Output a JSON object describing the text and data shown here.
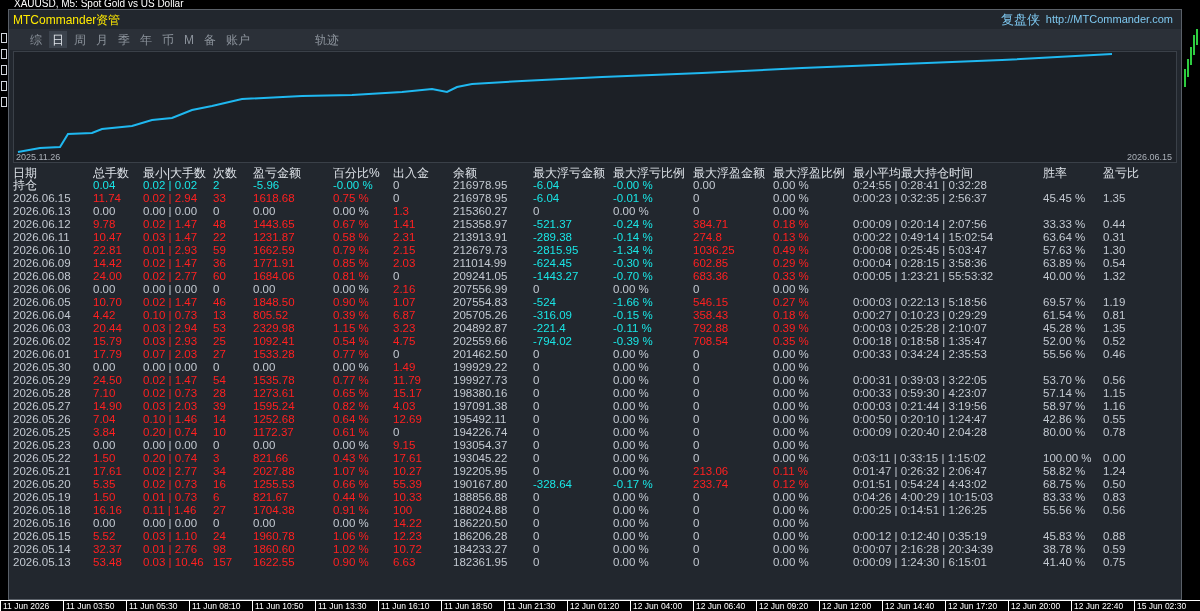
{
  "window": {
    "title": "XAUUSD, M5:  Spot Gold vs US Dollar"
  },
  "panel": {
    "title": "MTCommander资管",
    "brand": "复盘侠",
    "url": "http://MTCommander.com"
  },
  "tabs": [
    {
      "label": "综",
      "selected": false
    },
    {
      "label": "日",
      "selected": true
    },
    {
      "label": "周",
      "selected": false
    },
    {
      "label": "月",
      "selected": false
    },
    {
      "label": "季",
      "selected": false
    },
    {
      "label": "年",
      "selected": false
    },
    {
      "label": "币",
      "selected": false
    },
    {
      "label": "M",
      "selected": false
    },
    {
      "label": "备",
      "selected": false
    },
    {
      "label": "账户",
      "selected": false
    }
  ],
  "view_tab": {
    "label": "轨迹",
    "selected": false
  },
  "equity_chart": {
    "start_label": "2025.11.26",
    "end_label": "2026.06.15"
  },
  "table": {
    "columns": [
      "日期",
      "总手数",
      "最小|大手数",
      "次数",
      "盈亏金额",
      "百分比%",
      "出入金",
      "余额",
      "最大浮亏金额",
      "最大浮亏比例",
      "最大浮盈金额",
      "最大浮盈比例",
      "最小平均最大持仓时间",
      "胜率",
      "盈亏比"
    ],
    "rows": [
      {
        "cells": [
          {
            "text": "持仓",
            "kind": "label"
          },
          {
            "text": "0.04",
            "kind": "open"
          },
          {
            "text": "0.02 | 0.02",
            "kind": "open"
          },
          {
            "text": "2",
            "kind": "open"
          },
          {
            "text": "-5.96",
            "kind": "open"
          },
          {
            "text": "-0.00 %",
            "kind": "open"
          },
          {
            "text": "0",
            "kind": "plain"
          },
          {
            "text": "216978.95",
            "kind": "plain"
          },
          {
            "text": "-6.04",
            "kind": "open"
          },
          {
            "text": "-0.00 %",
            "kind": "open"
          },
          {
            "text": "0.00",
            "kind": "plain"
          },
          {
            "text": "0.00 %",
            "kind": "plain"
          },
          {
            "text": "0:24:55 | 0:28:41 | 0:32:28",
            "kind": "plain"
          }
        ]
      },
      {
        "cells": [
          {
            "text": "2026.06.15",
            "kind": "plain"
          },
          {
            "text": "11.74",
            "kind": "up"
          },
          {
            "text": "0.02 | 2.94",
            "kind": "up"
          },
          {
            "text": "33",
            "kind": "up"
          },
          {
            "text": "1618.68",
            "kind": "up"
          },
          {
            "text": "0.75 %",
            "kind": "up"
          },
          {
            "text": "0",
            "kind": "plain"
          },
          {
            "text": "216978.95",
            "kind": "plain"
          },
          {
            "text": "-6.04",
            "kind": "open"
          },
          {
            "text": "-0.01 %",
            "kind": "open"
          },
          {
            "text": "0",
            "kind": "plain"
          },
          {
            "text": "0.00 %",
            "kind": "plain"
          },
          {
            "text": "0:00:23 | 0:32:35 | 2:56:37",
            "kind": "plain"
          },
          {
            "text": "45.45 %",
            "kind": "plain"
          },
          {
            "text": "1.35",
            "kind": "plain"
          }
        ]
      },
      {
        "cells": [
          {
            "text": "2026.06.13",
            "kind": "plain"
          },
          {
            "text": "0.00",
            "kind": "plain"
          },
          {
            "text": "0.00 | 0.00",
            "kind": "plain"
          },
          {
            "text": "0",
            "kind": "plain"
          },
          {
            "text": "0.00",
            "kind": "plain"
          },
          {
            "text": "0.00 %",
            "kind": "plain"
          },
          {
            "text": "1.3",
            "kind": "up"
          },
          {
            "text": "215360.27",
            "kind": "plain"
          },
          {
            "text": "0",
            "kind": "plain"
          },
          {
            "text": "0.00 %",
            "kind": "plain"
          },
          {
            "text": "0",
            "kind": "plain"
          },
          {
            "text": "0.00 %",
            "kind": "plain"
          }
        ]
      },
      {
        "cells": [
          {
            "text": "2026.06.12",
            "kind": "plain"
          },
          {
            "text": "9.78",
            "kind": "up"
          },
          {
            "text": "0.02 | 1.47",
            "kind": "up"
          },
          {
            "text": "48",
            "kind": "up"
          },
          {
            "text": "1443.65",
            "kind": "up"
          },
          {
            "text": "0.67 %",
            "kind": "up"
          },
          {
            "text": "1.41",
            "kind": "up"
          },
          {
            "text": "215358.97",
            "kind": "plain"
          },
          {
            "text": "-521.37",
            "kind": "open"
          },
          {
            "text": "-0.24 %",
            "kind": "open"
          },
          {
            "text": "384.71",
            "kind": "up"
          },
          {
            "text": "0.18 %",
            "kind": "up"
          },
          {
            "text": "0:00:09 | 0:20:14 | 2:07:56",
            "kind": "plain"
          },
          {
            "text": "33.33 %",
            "kind": "plain"
          },
          {
            "text": "0.44",
            "kind": "plain"
          }
        ]
      },
      {
        "cells": [
          {
            "text": "2026.06.11",
            "kind": "plain"
          },
          {
            "text": "10.47",
            "kind": "up"
          },
          {
            "text": "0.03 | 1.47",
            "kind": "up"
          },
          {
            "text": "22",
            "kind": "up"
          },
          {
            "text": "1231.87",
            "kind": "up"
          },
          {
            "text": "0.58 %",
            "kind": "up"
          },
          {
            "text": "2.31",
            "kind": "up"
          },
          {
            "text": "213913.91",
            "kind": "plain"
          },
          {
            "text": "-289.38",
            "kind": "open"
          },
          {
            "text": "-0.14 %",
            "kind": "open"
          },
          {
            "text": "274.8",
            "kind": "up"
          },
          {
            "text": "0.13 %",
            "kind": "up"
          },
          {
            "text": "0:00:22 | 0:49:14 | 15:02:54",
            "kind": "plain"
          },
          {
            "text": "63.64 %",
            "kind": "plain"
          },
          {
            "text": "0.31",
            "kind": "plain"
          }
        ]
      },
      {
        "cells": [
          {
            "text": "2026.06.10",
            "kind": "plain"
          },
          {
            "text": "22.81",
            "kind": "up"
          },
          {
            "text": "0.01 | 2.93",
            "kind": "up"
          },
          {
            "text": "59",
            "kind": "up"
          },
          {
            "text": "1662.59",
            "kind": "up"
          },
          {
            "text": "0.79 %",
            "kind": "up"
          },
          {
            "text": "2.15",
            "kind": "up"
          },
          {
            "text": "212679.73",
            "kind": "plain"
          },
          {
            "text": "-2815.95",
            "kind": "open"
          },
          {
            "text": "-1.34 %",
            "kind": "open"
          },
          {
            "text": "1036.25",
            "kind": "up"
          },
          {
            "text": "0.49 %",
            "kind": "up"
          },
          {
            "text": "0:00:08 | 0:25:45 | 5:03:47",
            "kind": "plain"
          },
          {
            "text": "57.63 %",
            "kind": "plain"
          },
          {
            "text": "1.30",
            "kind": "plain"
          }
        ]
      },
      {
        "cells": [
          {
            "text": "2026.06.09",
            "kind": "plain"
          },
          {
            "text": "14.42",
            "kind": "up"
          },
          {
            "text": "0.02 | 1.47",
            "kind": "up"
          },
          {
            "text": "36",
            "kind": "up"
          },
          {
            "text": "1771.91",
            "kind": "up"
          },
          {
            "text": "0.85 %",
            "kind": "up"
          },
          {
            "text": "2.03",
            "kind": "up"
          },
          {
            "text": "211014.99",
            "kind": "plain"
          },
          {
            "text": "-624.45",
            "kind": "open"
          },
          {
            "text": "-0.30 %",
            "kind": "open"
          },
          {
            "text": "602.85",
            "kind": "up"
          },
          {
            "text": "0.29 %",
            "kind": "up"
          },
          {
            "text": "0:00:04 | 0:28:15 | 3:58:36",
            "kind": "plain"
          },
          {
            "text": "63.89 %",
            "kind": "plain"
          },
          {
            "text": "0.54",
            "kind": "plain"
          }
        ]
      },
      {
        "cells": [
          {
            "text": "2026.06.08",
            "kind": "plain"
          },
          {
            "text": "24.00",
            "kind": "up"
          },
          {
            "text": "0.02 | 2.77",
            "kind": "up"
          },
          {
            "text": "60",
            "kind": "up"
          },
          {
            "text": "1684.06",
            "kind": "up"
          },
          {
            "text": "0.81 %",
            "kind": "up"
          },
          {
            "text": "0",
            "kind": "plain"
          },
          {
            "text": "209241.05",
            "kind": "plain"
          },
          {
            "text": "-1443.27",
            "kind": "open"
          },
          {
            "text": "-0.70 %",
            "kind": "open"
          },
          {
            "text": "683.36",
            "kind": "up"
          },
          {
            "text": "0.33 %",
            "kind": "up"
          },
          {
            "text": "0:00:05 | 1:23:21 | 55:53:32",
            "kind": "plain"
          },
          {
            "text": "40.00 %",
            "kind": "plain"
          },
          {
            "text": "1.32",
            "kind": "plain"
          }
        ]
      },
      {
        "cells": [
          {
            "text": "2026.06.06",
            "kind": "plain"
          },
          {
            "text": "0.00",
            "kind": "plain"
          },
          {
            "text": "0.00 | 0.00",
            "kind": "plain"
          },
          {
            "text": "0",
            "kind": "plain"
          },
          {
            "text": "0.00",
            "kind": "plain"
          },
          {
            "text": "0.00 %",
            "kind": "plain"
          },
          {
            "text": "2.16",
            "kind": "up"
          },
          {
            "text": "207556.99",
            "kind": "plain"
          },
          {
            "text": "0",
            "kind": "plain"
          },
          {
            "text": "0.00 %",
            "kind": "plain"
          },
          {
            "text": "0",
            "kind": "plain"
          },
          {
            "text": "0.00 %",
            "kind": "plain"
          }
        ]
      },
      {
        "cells": [
          {
            "text": "2026.06.05",
            "kind": "plain"
          },
          {
            "text": "10.70",
            "kind": "up"
          },
          {
            "text": "0.02 | 1.47",
            "kind": "up"
          },
          {
            "text": "46",
            "kind": "up"
          },
          {
            "text": "1848.50",
            "kind": "up"
          },
          {
            "text": "0.90 %",
            "kind": "up"
          },
          {
            "text": "1.07",
            "kind": "up"
          },
          {
            "text": "207554.83",
            "kind": "plain"
          },
          {
            "text": "-524",
            "kind": "open"
          },
          {
            "text": "-1.66 %",
            "kind": "open"
          },
          {
            "text": "546.15",
            "kind": "up"
          },
          {
            "text": "0.27 %",
            "kind": "up"
          },
          {
            "text": "0:00:03 | 0:22:13 | 5:18:56",
            "kind": "plain"
          },
          {
            "text": "69.57 %",
            "kind": "plain"
          },
          {
            "text": "1.19",
            "kind": "plain"
          }
        ]
      },
      {
        "cells": [
          {
            "text": "2026.06.04",
            "kind": "plain"
          },
          {
            "text": "4.42",
            "kind": "up"
          },
          {
            "text": "0.10 | 0.73",
            "kind": "up"
          },
          {
            "text": "13",
            "kind": "up"
          },
          {
            "text": "805.52",
            "kind": "up"
          },
          {
            "text": "0.39 %",
            "kind": "up"
          },
          {
            "text": "6.87",
            "kind": "up"
          },
          {
            "text": "205705.26",
            "kind": "plain"
          },
          {
            "text": "-316.09",
            "kind": "open"
          },
          {
            "text": "-0.15 %",
            "kind": "open"
          },
          {
            "text": "358.43",
            "kind": "up"
          },
          {
            "text": "0.18 %",
            "kind": "up"
          },
          {
            "text": "0:00:27 | 0:10:23 | 0:29:29",
            "kind": "plain"
          },
          {
            "text": "61.54 %",
            "kind": "plain"
          },
          {
            "text": "0.81",
            "kind": "plain"
          }
        ]
      },
      {
        "cells": [
          {
            "text": "2026.06.03",
            "kind": "plain"
          },
          {
            "text": "20.44",
            "kind": "up"
          },
          {
            "text": "0.03 | 2.94",
            "kind": "up"
          },
          {
            "text": "53",
            "kind": "up"
          },
          {
            "text": "2329.98",
            "kind": "up"
          },
          {
            "text": "1.15 %",
            "kind": "up"
          },
          {
            "text": "3.23",
            "kind": "up"
          },
          {
            "text": "204892.87",
            "kind": "plain"
          },
          {
            "text": "-221.4",
            "kind": "open"
          },
          {
            "text": "-0.11 %",
            "kind": "open"
          },
          {
            "text": "792.88",
            "kind": "up"
          },
          {
            "text": "0.39 %",
            "kind": "up"
          },
          {
            "text": "0:00:03 | 0:25:28 | 2:10:07",
            "kind": "plain"
          },
          {
            "text": "45.28 %",
            "kind": "plain"
          },
          {
            "text": "1.35",
            "kind": "plain"
          }
        ]
      },
      {
        "cells": [
          {
            "text": "2026.06.02",
            "kind": "plain"
          },
          {
            "text": "15.79",
            "kind": "up"
          },
          {
            "text": "0.03 | 2.93",
            "kind": "up"
          },
          {
            "text": "25",
            "kind": "up"
          },
          {
            "text": "1092.41",
            "kind": "up"
          },
          {
            "text": "0.54 %",
            "kind": "up"
          },
          {
            "text": "4.75",
            "kind": "up"
          },
          {
            "text": "202559.66",
            "kind": "plain"
          },
          {
            "text": "-794.02",
            "kind": "open"
          },
          {
            "text": "-0.39 %",
            "kind": "open"
          },
          {
            "text": "708.54",
            "kind": "up"
          },
          {
            "text": "0.35 %",
            "kind": "up"
          },
          {
            "text": "0:00:18 | 0:18:58 | 1:35:47",
            "kind": "plain"
          },
          {
            "text": "52.00 %",
            "kind": "plain"
          },
          {
            "text": "0.52",
            "kind": "plain"
          }
        ]
      },
      {
        "cells": [
          {
            "text": "2026.06.01",
            "kind": "plain"
          },
          {
            "text": "17.79",
            "kind": "up"
          },
          {
            "text": "0.07 | 2.03",
            "kind": "up"
          },
          {
            "text": "27",
            "kind": "up"
          },
          {
            "text": "1533.28",
            "kind": "up"
          },
          {
            "text": "0.77 %",
            "kind": "up"
          },
          {
            "text": "0",
            "kind": "plain"
          },
          {
            "text": "201462.50",
            "kind": "plain"
          },
          {
            "text": "0",
            "kind": "plain"
          },
          {
            "text": "0.00 %",
            "kind": "plain"
          },
          {
            "text": "0",
            "kind": "plain"
          },
          {
            "text": "0.00 %",
            "kind": "plain"
          },
          {
            "text": "0:00:33 | 0:34:24 | 2:35:53",
            "kind": "plain"
          },
          {
            "text": "55.56 %",
            "kind": "plain"
          },
          {
            "text": "0.46",
            "kind": "plain"
          }
        ]
      },
      {
        "cells": [
          {
            "text": "2026.05.30",
            "kind": "plain"
          },
          {
            "text": "0.00",
            "kind": "plain"
          },
          {
            "text": "0.00 | 0.00",
            "kind": "plain"
          },
          {
            "text": "0",
            "kind": "plain"
          },
          {
            "text": "0.00",
            "kind": "plain"
          },
          {
            "text": "0.00 %",
            "kind": "plain"
          },
          {
            "text": "1.49",
            "kind": "up"
          },
          {
            "text": "199929.22",
            "kind": "plain"
          },
          {
            "text": "0",
            "kind": "plain"
          },
          {
            "text": "0.00 %",
            "kind": "plain"
          },
          {
            "text": "0",
            "kind": "plain"
          },
          {
            "text": "0.00 %",
            "kind": "plain"
          }
        ]
      },
      {
        "cells": [
          {
            "text": "2026.05.29",
            "kind": "plain"
          },
          {
            "text": "24.50",
            "kind": "up"
          },
          {
            "text": "0.02 | 1.47",
            "kind": "up"
          },
          {
            "text": "54",
            "kind": "up"
          },
          {
            "text": "1535.78",
            "kind": "up"
          },
          {
            "text": "0.77 %",
            "kind": "up"
          },
          {
            "text": "11.79",
            "kind": "up"
          },
          {
            "text": "199927.73",
            "kind": "plain"
          },
          {
            "text": "0",
            "kind": "plain"
          },
          {
            "text": "0.00 %",
            "kind": "plain"
          },
          {
            "text": "0",
            "kind": "plain"
          },
          {
            "text": "0.00 %",
            "kind": "plain"
          },
          {
            "text": "0:00:31 | 0:39:03 | 3:22:05",
            "kind": "plain"
          },
          {
            "text": "53.70 %",
            "kind": "plain"
          },
          {
            "text": "0.56",
            "kind": "plain"
          }
        ]
      },
      {
        "cells": [
          {
            "text": "2026.05.28",
            "kind": "plain"
          },
          {
            "text": "7.10",
            "kind": "up"
          },
          {
            "text": "0.02 | 0.73",
            "kind": "up"
          },
          {
            "text": "28",
            "kind": "up"
          },
          {
            "text": "1273.61",
            "kind": "up"
          },
          {
            "text": "0.65 %",
            "kind": "up"
          },
          {
            "text": "15.17",
            "kind": "up"
          },
          {
            "text": "198380.16",
            "kind": "plain"
          },
          {
            "text": "0",
            "kind": "plain"
          },
          {
            "text": "0.00 %",
            "kind": "plain"
          },
          {
            "text": "0",
            "kind": "plain"
          },
          {
            "text": "0.00 %",
            "kind": "plain"
          },
          {
            "text": "0:00:33 | 0:59:30 | 4:23:07",
            "kind": "plain"
          },
          {
            "text": "57.14 %",
            "kind": "plain"
          },
          {
            "text": "1.15",
            "kind": "plain"
          }
        ]
      },
      {
        "cells": [
          {
            "text": "2026.05.27",
            "kind": "plain"
          },
          {
            "text": "14.90",
            "kind": "up"
          },
          {
            "text": "0.03 | 2.03",
            "kind": "up"
          },
          {
            "text": "39",
            "kind": "up"
          },
          {
            "text": "1595.24",
            "kind": "up"
          },
          {
            "text": "0.82 %",
            "kind": "up"
          },
          {
            "text": "4.03",
            "kind": "up"
          },
          {
            "text": "197091.38",
            "kind": "plain"
          },
          {
            "text": "0",
            "kind": "plain"
          },
          {
            "text": "0.00 %",
            "kind": "plain"
          },
          {
            "text": "0",
            "kind": "plain"
          },
          {
            "text": "0.00 %",
            "kind": "plain"
          },
          {
            "text": "0:00:03 | 0:21:44 | 3:19:56",
            "kind": "plain"
          },
          {
            "text": "58.97 %",
            "kind": "plain"
          },
          {
            "text": "1.16",
            "kind": "plain"
          }
        ]
      },
      {
        "cells": [
          {
            "text": "2026.05.26",
            "kind": "plain"
          },
          {
            "text": "7.04",
            "kind": "up"
          },
          {
            "text": "0.10 | 1.46",
            "kind": "up"
          },
          {
            "text": "14",
            "kind": "up"
          },
          {
            "text": "1252.68",
            "kind": "up"
          },
          {
            "text": "0.64 %",
            "kind": "up"
          },
          {
            "text": "12.69",
            "kind": "up"
          },
          {
            "text": "195492.11",
            "kind": "plain"
          },
          {
            "text": "0",
            "kind": "plain"
          },
          {
            "text": "0.00 %",
            "kind": "plain"
          },
          {
            "text": "0",
            "kind": "plain"
          },
          {
            "text": "0.00 %",
            "kind": "plain"
          },
          {
            "text": "0:00:50 | 0:20:10 | 1:24:47",
            "kind": "plain"
          },
          {
            "text": "42.86 %",
            "kind": "plain"
          },
          {
            "text": "0.55",
            "kind": "plain"
          }
        ]
      },
      {
        "cells": [
          {
            "text": "2026.05.25",
            "kind": "plain"
          },
          {
            "text": "3.84",
            "kind": "up"
          },
          {
            "text": "0.20 | 0.74",
            "kind": "up"
          },
          {
            "text": "10",
            "kind": "up"
          },
          {
            "text": "1172.37",
            "kind": "up"
          },
          {
            "text": "0.61 %",
            "kind": "up"
          },
          {
            "text": "0",
            "kind": "plain"
          },
          {
            "text": "194226.74",
            "kind": "plain"
          },
          {
            "text": "0",
            "kind": "plain"
          },
          {
            "text": "0.00 %",
            "kind": "plain"
          },
          {
            "text": "0",
            "kind": "plain"
          },
          {
            "text": "0.00 %",
            "kind": "plain"
          },
          {
            "text": "0:00:09 | 0:20:40 | 2:04:28",
            "kind": "plain"
          },
          {
            "text": "80.00 %",
            "kind": "plain"
          },
          {
            "text": "0.78",
            "kind": "plain"
          }
        ]
      },
      {
        "cells": [
          {
            "text": "2026.05.23",
            "kind": "plain"
          },
          {
            "text": "0.00",
            "kind": "plain"
          },
          {
            "text": "0.00 | 0.00",
            "kind": "plain"
          },
          {
            "text": "0",
            "kind": "plain"
          },
          {
            "text": "0.00",
            "kind": "plain"
          },
          {
            "text": "0.00 %",
            "kind": "plain"
          },
          {
            "text": "9.15",
            "kind": "up"
          },
          {
            "text": "193054.37",
            "kind": "plain"
          },
          {
            "text": "0",
            "kind": "plain"
          },
          {
            "text": "0.00 %",
            "kind": "plain"
          },
          {
            "text": "0",
            "kind": "plain"
          },
          {
            "text": "0.00 %",
            "kind": "plain"
          }
        ]
      },
      {
        "cells": [
          {
            "text": "2026.05.22",
            "kind": "plain"
          },
          {
            "text": "1.50",
            "kind": "up"
          },
          {
            "text": "0.20 | 0.74",
            "kind": "up"
          },
          {
            "text": "3",
            "kind": "up"
          },
          {
            "text": "821.66",
            "kind": "up"
          },
          {
            "text": "0.43 %",
            "kind": "up"
          },
          {
            "text": "17.61",
            "kind": "up"
          },
          {
            "text": "193045.22",
            "kind": "plain"
          },
          {
            "text": "0",
            "kind": "plain"
          },
          {
            "text": "0.00 %",
            "kind": "plain"
          },
          {
            "text": "0",
            "kind": "plain"
          },
          {
            "text": "0.00 %",
            "kind": "plain"
          },
          {
            "text": "0:03:11 | 0:33:15 | 1:15:02",
            "kind": "plain"
          },
          {
            "text": "100.00 %",
            "kind": "plain"
          },
          {
            "text": "0.00",
            "kind": "plain"
          }
        ]
      },
      {
        "cells": [
          {
            "text": "2026.05.21",
            "kind": "plain"
          },
          {
            "text": "17.61",
            "kind": "up"
          },
          {
            "text": "0.02 | 2.77",
            "kind": "up"
          },
          {
            "text": "34",
            "kind": "up"
          },
          {
            "text": "2027.88",
            "kind": "up"
          },
          {
            "text": "1.07 %",
            "kind": "up"
          },
          {
            "text": "10.27",
            "kind": "up"
          },
          {
            "text": "192205.95",
            "kind": "plain"
          },
          {
            "text": "0",
            "kind": "plain"
          },
          {
            "text": "0.00 %",
            "kind": "plain"
          },
          {
            "text": "213.06",
            "kind": "up"
          },
          {
            "text": "0.11 %",
            "kind": "up"
          },
          {
            "text": "0:01:47 | 0:26:32 | 2:06:47",
            "kind": "plain"
          },
          {
            "text": "58.82 %",
            "kind": "plain"
          },
          {
            "text": "1.24",
            "kind": "plain"
          }
        ]
      },
      {
        "cells": [
          {
            "text": "2026.05.20",
            "kind": "plain"
          },
          {
            "text": "5.35",
            "kind": "up"
          },
          {
            "text": "0.02 | 0.73",
            "kind": "up"
          },
          {
            "text": "16",
            "kind": "up"
          },
          {
            "text": "1255.53",
            "kind": "up"
          },
          {
            "text": "0.66 %",
            "kind": "up"
          },
          {
            "text": "55.39",
            "kind": "up"
          },
          {
            "text": "190167.80",
            "kind": "plain"
          },
          {
            "text": "-328.64",
            "kind": "open"
          },
          {
            "text": "-0.17 %",
            "kind": "open"
          },
          {
            "text": "233.74",
            "kind": "up"
          },
          {
            "text": "0.12 %",
            "kind": "up"
          },
          {
            "text": "0:01:51 | 0:54:24 | 4:43:02",
            "kind": "plain"
          },
          {
            "text": "68.75 %",
            "kind": "plain"
          },
          {
            "text": "0.50",
            "kind": "plain"
          }
        ]
      },
      {
        "cells": [
          {
            "text": "2026.05.19",
            "kind": "plain"
          },
          {
            "text": "1.50",
            "kind": "up"
          },
          {
            "text": "0.01 | 0.73",
            "kind": "up"
          },
          {
            "text": "6",
            "kind": "up"
          },
          {
            "text": "821.67",
            "kind": "up"
          },
          {
            "text": "0.44 %",
            "kind": "up"
          },
          {
            "text": "10.33",
            "kind": "up"
          },
          {
            "text": "188856.88",
            "kind": "plain"
          },
          {
            "text": "0",
            "kind": "plain"
          },
          {
            "text": "0.00 %",
            "kind": "plain"
          },
          {
            "text": "0",
            "kind": "plain"
          },
          {
            "text": "0.00 %",
            "kind": "plain"
          },
          {
            "text": "0:04:26 | 4:00:29 | 10:15:03",
            "kind": "plain"
          },
          {
            "text": "83.33 %",
            "kind": "plain"
          },
          {
            "text": "0.83",
            "kind": "plain"
          }
        ]
      },
      {
        "cells": [
          {
            "text": "2026.05.18",
            "kind": "plain"
          },
          {
            "text": "16.16",
            "kind": "up"
          },
          {
            "text": "0.11 | 1.46",
            "kind": "up"
          },
          {
            "text": "27",
            "kind": "up"
          },
          {
            "text": "1704.38",
            "kind": "up"
          },
          {
            "text": "0.91 %",
            "kind": "up"
          },
          {
            "text": "100",
            "kind": "up"
          },
          {
            "text": "188024.88",
            "kind": "plain"
          },
          {
            "text": "0",
            "kind": "plain"
          },
          {
            "text": "0.00 %",
            "kind": "plain"
          },
          {
            "text": "0",
            "kind": "plain"
          },
          {
            "text": "0.00 %",
            "kind": "plain"
          },
          {
            "text": "0:00:25 | 0:14:51 | 1:26:25",
            "kind": "plain"
          },
          {
            "text": "55.56 %",
            "kind": "plain"
          },
          {
            "text": "0.56",
            "kind": "plain"
          }
        ]
      },
      {
        "cells": [
          {
            "text": "2026.05.16",
            "kind": "plain"
          },
          {
            "text": "0.00",
            "kind": "plain"
          },
          {
            "text": "0.00 | 0.00",
            "kind": "plain"
          },
          {
            "text": "0",
            "kind": "plain"
          },
          {
            "text": "0.00",
            "kind": "plain"
          },
          {
            "text": "0.00 %",
            "kind": "plain"
          },
          {
            "text": "14.22",
            "kind": "up"
          },
          {
            "text": "186220.50",
            "kind": "plain"
          },
          {
            "text": "0",
            "kind": "plain"
          },
          {
            "text": "0.00 %",
            "kind": "plain"
          },
          {
            "text": "0",
            "kind": "plain"
          },
          {
            "text": "0.00 %",
            "kind": "plain"
          }
        ]
      },
      {
        "cells": [
          {
            "text": "2026.05.15",
            "kind": "plain"
          },
          {
            "text": "5.52",
            "kind": "up"
          },
          {
            "text": "0.03 | 1.10",
            "kind": "up"
          },
          {
            "text": "24",
            "kind": "up"
          },
          {
            "text": "1960.78",
            "kind": "up"
          },
          {
            "text": "1.06 %",
            "kind": "up"
          },
          {
            "text": "12.23",
            "kind": "up"
          },
          {
            "text": "186206.28",
            "kind": "plain"
          },
          {
            "text": "0",
            "kind": "plain"
          },
          {
            "text": "0.00 %",
            "kind": "plain"
          },
          {
            "text": "0",
            "kind": "plain"
          },
          {
            "text": "0.00 %",
            "kind": "plain"
          },
          {
            "text": "0:00:12 | 0:12:40 | 0:35:19",
            "kind": "plain"
          },
          {
            "text": "45.83 %",
            "kind": "plain"
          },
          {
            "text": "0.88",
            "kind": "plain"
          }
        ]
      },
      {
        "cells": [
          {
            "text": "2026.05.14",
            "kind": "plain"
          },
          {
            "text": "32.37",
            "kind": "up"
          },
          {
            "text": "0.01 | 2.76",
            "kind": "up"
          },
          {
            "text": "98",
            "kind": "up"
          },
          {
            "text": "1860.60",
            "kind": "up"
          },
          {
            "text": "1.02 %",
            "kind": "up"
          },
          {
            "text": "10.72",
            "kind": "up"
          },
          {
            "text": "184233.27",
            "kind": "plain"
          },
          {
            "text": "0",
            "kind": "plain"
          },
          {
            "text": "0.00 %",
            "kind": "plain"
          },
          {
            "text": "0",
            "kind": "plain"
          },
          {
            "text": "0.00 %",
            "kind": "plain"
          },
          {
            "text": "0:00:07 | 2:16:28 | 20:34:39",
            "kind": "plain"
          },
          {
            "text": "38.78 %",
            "kind": "plain"
          },
          {
            "text": "0.59",
            "kind": "plain"
          }
        ]
      },
      {
        "cells": [
          {
            "text": "2026.05.13",
            "kind": "plain"
          },
          {
            "text": "53.48",
            "kind": "up"
          },
          {
            "text": "0.03 | 10.46",
            "kind": "up"
          },
          {
            "text": "157",
            "kind": "up"
          },
          {
            "text": "1622.55",
            "kind": "up"
          },
          {
            "text": "0.90 %",
            "kind": "up"
          },
          {
            "text": "6.63",
            "kind": "up"
          },
          {
            "text": "182361.95",
            "kind": "plain"
          },
          {
            "text": "0",
            "kind": "plain"
          },
          {
            "text": "0.00 %",
            "kind": "plain"
          },
          {
            "text": "0",
            "kind": "plain"
          },
          {
            "text": "0.00 %",
            "kind": "plain"
          },
          {
            "text": "0:00:09 | 1:24:30 | 6:15:01",
            "kind": "plain"
          },
          {
            "text": "41.40 %",
            "kind": "plain"
          },
          {
            "text": "0.75",
            "kind": "plain"
          }
        ]
      }
    ]
  },
  "time_axis": [
    "11 Jun 2026",
    "11 Jun 03:50",
    "11 Jun 05:30",
    "11 Jun 08:10",
    "11 Jun 10:50",
    "11 Jun 13:30",
    "11 Jun 16:10",
    "11 Jun 18:50",
    "11 Jun 21:30",
    "12 Jun 01:20",
    "12 Jun 04:00",
    "12 Jun 06:40",
    "12 Jun 09:20",
    "12 Jun 12:00",
    "12 Jun 14:40",
    "12 Jun 17:20",
    "12 Jun 20:00",
    "12 Jun 22:40",
    "15 Jun 02:30"
  ]
}
